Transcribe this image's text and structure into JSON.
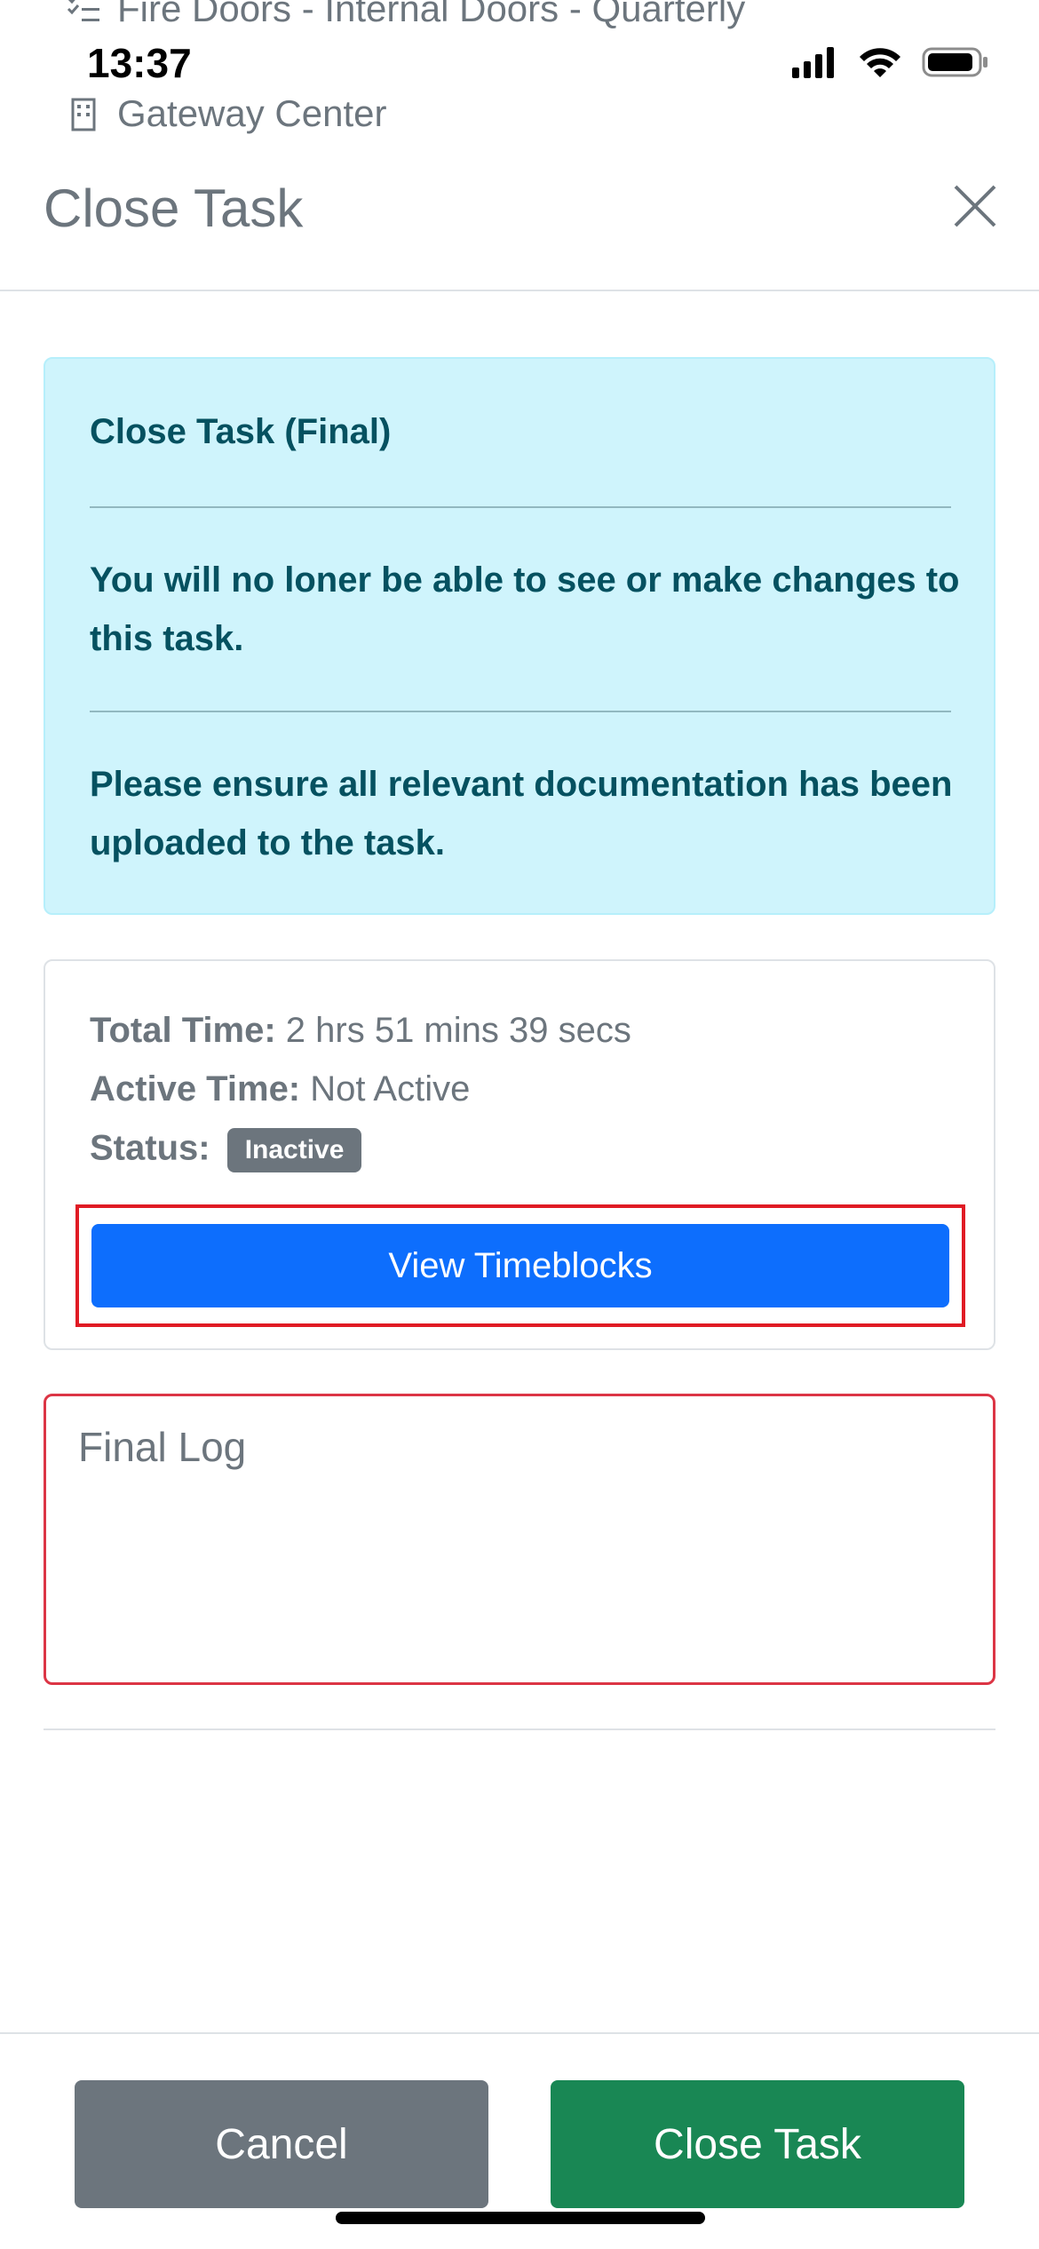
{
  "background": {
    "task_title": "Fire Doors - Internal Doors - Quarterly",
    "location": "Gateway Center"
  },
  "status_bar": {
    "time": "13:37"
  },
  "modal": {
    "title": "Close Task",
    "alert": {
      "heading": "Close Task (Final)",
      "paragraph1": "You will no loner be able to see or make changes to this task.",
      "paragraph2": "Please ensure all relevant documentation has been uploaded to the task."
    },
    "time_info": {
      "total_label": "Total Time:",
      "total_value": "2 hrs 51 mins 39 secs",
      "active_label": "Active Time:",
      "active_value": "Not Active",
      "status_label": "Status:",
      "status_badge": "Inactive"
    },
    "view_timeblocks_label": "View Timeblocks",
    "final_log": {
      "placeholder": "Final Log",
      "value": ""
    },
    "footer": {
      "cancel_label": "Cancel",
      "close_label": "Close Task"
    }
  },
  "colors": {
    "primary": "#0d6efd",
    "success": "#198754",
    "secondary": "#6c757d",
    "info_bg": "#cff4fc",
    "danger": "#dc3545"
  }
}
